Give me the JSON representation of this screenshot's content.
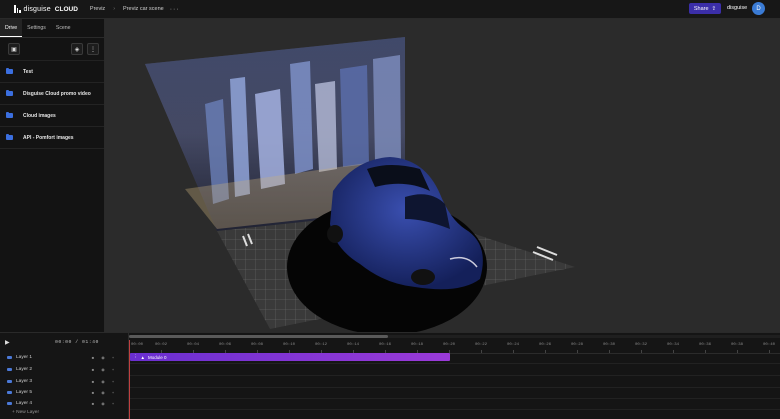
{
  "app": {
    "logo_text": "disguise",
    "logo_cloud": "CLOUD"
  },
  "breadcrumb": [
    "Previz",
    "Previz car scene"
  ],
  "header": {
    "share_label": "Share",
    "user_name": "disguise",
    "avatar_initial": "D"
  },
  "sidebar": {
    "tabs": [
      "Drive",
      "Settings",
      "Scene"
    ],
    "folders": [
      "Test",
      "Disguise Cloud promo video",
      "Cloud images",
      "API - Pomfort images"
    ]
  },
  "timeline": {
    "timecode": "00:00 / 01:40",
    "layers": [
      "Layer 1",
      "Layer 2",
      "Layer 3",
      "Layer 5",
      "Layer 4"
    ],
    "new_layer_label": "+ New Layer",
    "ticks": [
      "00:00",
      "00:02",
      "00:04",
      "00:06",
      "00:08",
      "00:10",
      "00:12",
      "00:14",
      "00:16",
      "00:18",
      "00:20",
      "00:22",
      "00:24",
      "00:26",
      "00:28",
      "00:30",
      "00:32",
      "00:34",
      "00:36",
      "00:38",
      "00:40"
    ],
    "clip_label": "Module 0"
  },
  "colors": {
    "accent": "#3b2ea8",
    "folder": "#3b6fe0",
    "clip": "#8a35d6"
  }
}
